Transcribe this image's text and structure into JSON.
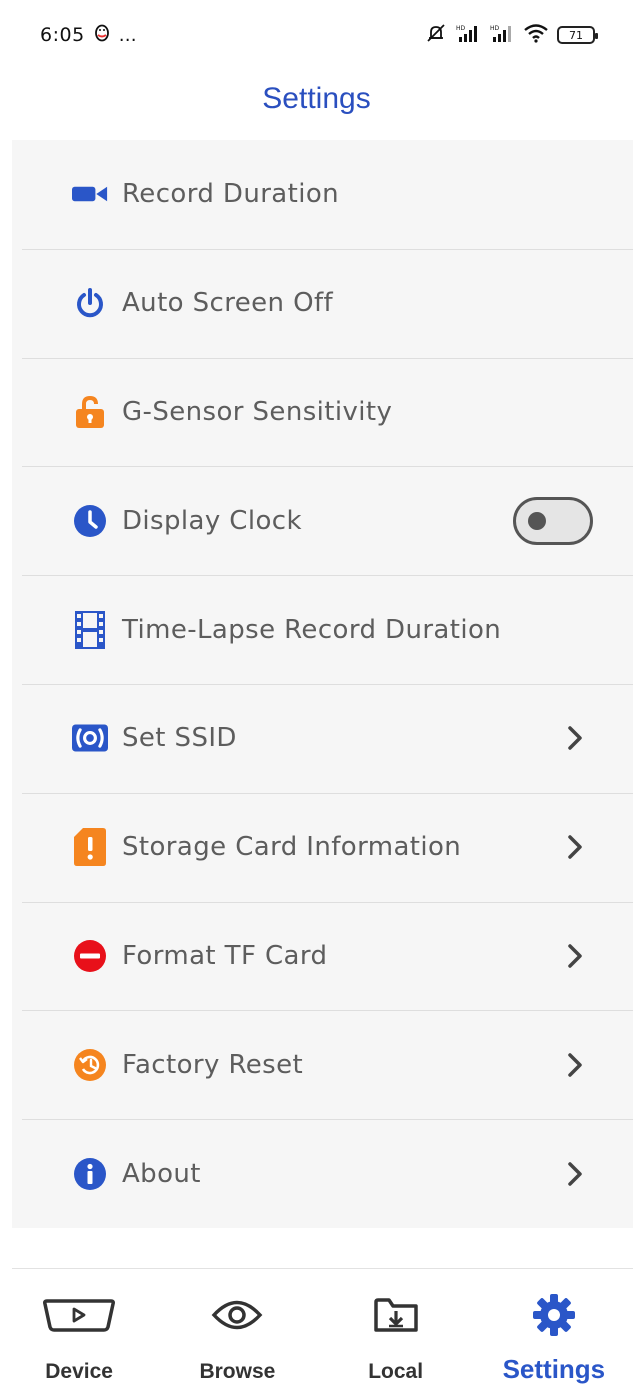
{
  "status_bar": {
    "time": "6:05",
    "dots": "…",
    "battery": "71",
    "icons": [
      "penguin-icon",
      "mute-icon",
      "signal-hd-icon",
      "signal-hd-icon",
      "wifi-icon",
      "battery-icon"
    ]
  },
  "header": {
    "title": "Settings"
  },
  "settings": {
    "record_duration": "Record Duration",
    "auto_screen_off": "Auto Screen Off",
    "g_sensor": "G-Sensor Sensitivity",
    "display_clock": "Display Clock",
    "display_clock_on": false,
    "time_lapse": "Time-Lapse Record Duration",
    "set_ssid": "Set SSID",
    "storage_card": "Storage Card Information",
    "format_tf": "Format TF Card",
    "factory_reset": "Factory Reset",
    "about": "About"
  },
  "colors": {
    "blue": "#2a56c8",
    "orange": "#f5851f",
    "red": "#e8101a",
    "text": "#5d5d5d"
  },
  "nav": {
    "device": "Device",
    "browse": "Browse",
    "local": "Local",
    "settings": "Settings",
    "active": "settings"
  }
}
